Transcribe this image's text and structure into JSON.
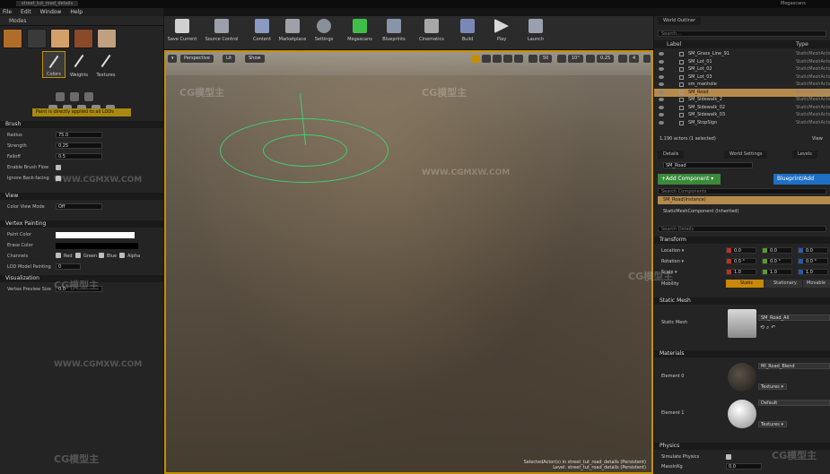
{
  "app": {
    "window_tab": "street_tut_road_details",
    "user_badge": "Megascans"
  },
  "menu": [
    "File",
    "Edit",
    "Window",
    "Help"
  ],
  "modes": {
    "tab_label": "Modes",
    "tools": [
      {
        "label": "Colors"
      },
      {
        "label": "Weights"
      },
      {
        "label": "Textures"
      }
    ],
    "lod_note": "Paint is directly applied to all LODs",
    "brush": {
      "section": "Brush",
      "radius_label": "Radius",
      "radius_value": "75.0",
      "strength_label": "Strength",
      "strength_value": "0.25",
      "falloff_label": "Falloff",
      "falloff_value": "0.5",
      "enable_flow_label": "Enable Brush Flow",
      "ignore_backfacing_label": "Ignore Back-facing"
    },
    "view": {
      "section": "View",
      "color_view_mode_label": "Color View Mode",
      "color_view_mode_value": "Off"
    },
    "vertex_painting": {
      "section": "Vertex Painting",
      "paint_color_label": "Paint Color",
      "erase_color_label": "Erase Color",
      "channels_label": "Channels",
      "channels": [
        "Red",
        "Green",
        "Blue",
        "Alpha"
      ],
      "lod_model_painting_label": "LOD Model Painting",
      "lod_model_painting_value": "0"
    },
    "visualization": {
      "section": "Visualization",
      "vertex_preview_size_label": "Vertex Preview Size",
      "vertex_preview_size_value": "0.0"
    }
  },
  "toolbar": [
    {
      "label": "Save Current",
      "icon": "save-icon"
    },
    {
      "label": "Source Control",
      "icon": "source-control-icon"
    },
    {
      "label": "Content",
      "icon": "content-icon"
    },
    {
      "label": "Marketplace",
      "icon": "marketplace-icon"
    },
    {
      "label": "Settings",
      "icon": "settings-icon"
    },
    {
      "label": "Megascans",
      "icon": "megascans-icon"
    },
    {
      "label": "Blueprints",
      "icon": "blueprints-icon"
    },
    {
      "label": "Cinematics",
      "icon": "cinematics-icon"
    },
    {
      "label": "Build",
      "icon": "build-icon"
    },
    {
      "label": "Play",
      "icon": "play-icon"
    },
    {
      "label": "Launch",
      "icon": "launch-icon"
    }
  ],
  "viewport": {
    "perspective_label": "Perspective",
    "lit_label": "Lit",
    "show_label": "Show",
    "grid_snap": "50",
    "rot_snap": "10°",
    "scale_snap": "0.25",
    "camera_speed": "4",
    "status_line1": "SelectedActor(s) in street_tut_road_details (Persistent)",
    "status_line2": "Level:  street_tut_road_details (Persistent)"
  },
  "outliner": {
    "tab_label": "World Outliner",
    "search_placeholder": "Search...",
    "col_label": "Label",
    "col_type": "Type",
    "rows": [
      {
        "name": "SM_Grass_Line_91",
        "type": "StaticMeshActor",
        "selected": false
      },
      {
        "name": "SM_Lot_01",
        "type": "StaticMeshActor",
        "selected": false
      },
      {
        "name": "SM_Lot_02",
        "type": "StaticMeshActor",
        "selected": false
      },
      {
        "name": "SM_Lot_03",
        "type": "StaticMeshActor",
        "selected": false
      },
      {
        "name": "sm_manhole",
        "type": "StaticMeshActor",
        "selected": false
      },
      {
        "name": "SM_Road",
        "type": "StaticMeshActor",
        "selected": true
      },
      {
        "name": "SM_Sidewalk_2",
        "type": "StaticMeshActor",
        "selected": false
      },
      {
        "name": "SM_Sidewalk_02",
        "type": "StaticMeshActor",
        "selected": false
      },
      {
        "name": "SM_Sidewalk_03",
        "type": "StaticMeshActor",
        "selected": false
      },
      {
        "name": "SM_StopSign",
        "type": "StaticMeshActor",
        "selected": false
      }
    ],
    "actor_count": "1,190 actors (1 selected)",
    "view_options": "View"
  },
  "details": {
    "tabs": [
      "Details",
      "World Settings",
      "Levels"
    ],
    "actor_name": "SM_Road",
    "add_component": "+Add Component ▾",
    "blueprint_button": "Blueprint/Add",
    "search_components_placeholder": "Search Components",
    "component_instance": "SM_Road(Instance)",
    "component_child": "StaticMeshComponent (Inherited)",
    "search_details_placeholder": "Search Details",
    "transform": {
      "section": "Transform",
      "location_label": "Location ▾",
      "location": [
        "0.0",
        "0.0",
        "0.0"
      ],
      "rotation_label": "Rotation ▾",
      "rotation": [
        "0.0 °",
        "0.0 °",
        "0.0 °"
      ],
      "scale_label": "Scale ▾",
      "scale": [
        "1.0",
        "1.0",
        "1.0"
      ],
      "mobility_label": "Mobility",
      "mobility_options": [
        "Static",
        "Stationary",
        "Movable"
      ]
    },
    "static_mesh": {
      "section": "Static Mesh",
      "label": "Static Mesh",
      "value": "SM_Road_All"
    },
    "materials": {
      "section": "Materials",
      "elements": [
        {
          "label": "Element 0",
          "value": "MI_Road_Blend",
          "textures": "Textures ▾"
        },
        {
          "label": "Element 1",
          "value": "Default",
          "textures": "Textures ▾"
        }
      ]
    },
    "physics": {
      "section": "Physics",
      "simulate_label": "Simulate Physics",
      "mass_label": "MassInKg",
      "mass_value": "0.0"
    }
  },
  "watermark": {
    "brand": "CG模型主",
    "site": "WWW.CGMXW.COM"
  },
  "colors": {
    "accent": "#c49000",
    "selected_row": "#b58a4d",
    "add_component": "#3a8a3a",
    "blueprint": "#1f6fc4",
    "mobility_active": "#c8880a"
  }
}
